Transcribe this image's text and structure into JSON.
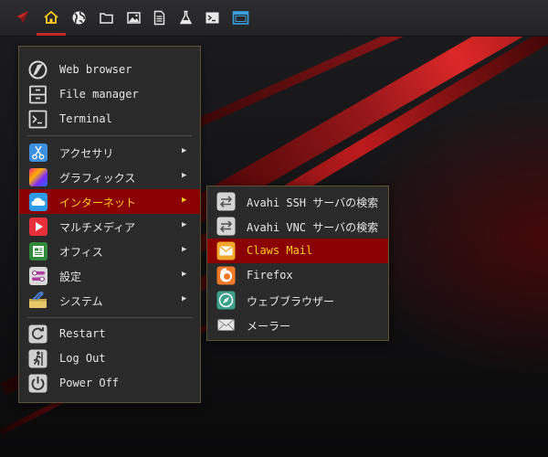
{
  "panel": {
    "buttons": [
      {
        "name": "launcher-button",
        "icon": "rocket-icon"
      },
      {
        "name": "home-button",
        "icon": "home-icon"
      },
      {
        "name": "browser-button",
        "icon": "globe-icon"
      },
      {
        "name": "files-button",
        "icon": "folder-icon"
      },
      {
        "name": "images-button",
        "icon": "image-icon"
      },
      {
        "name": "documents-button",
        "icon": "document-icon"
      },
      {
        "name": "science-button",
        "icon": "flask-icon"
      },
      {
        "name": "terminal-button",
        "icon": "terminal-icon"
      },
      {
        "name": "desktop-button",
        "icon": "window-icon"
      }
    ],
    "accent": "#c0282a",
    "home_color": "#ffcc1f",
    "window_icon_color": "#3aa0e0"
  },
  "main_menu": {
    "favorites": [
      {
        "label": "Web browser",
        "icon": "web-browser-icon"
      },
      {
        "label": "File manager",
        "icon": "file-manager-icon"
      },
      {
        "label": "Terminal",
        "icon": "terminal-icon"
      }
    ],
    "categories": [
      {
        "label": "アクセサリ",
        "icon": "accessories-icon",
        "active": false
      },
      {
        "label": "グラフィックス",
        "icon": "graphics-icon",
        "active": false
      },
      {
        "label": "インターネット",
        "icon": "internet-icon",
        "active": true
      },
      {
        "label": "マルチメディア",
        "icon": "multimedia-icon",
        "active": false
      },
      {
        "label": "オフィス",
        "icon": "office-icon",
        "active": false
      },
      {
        "label": "設定",
        "icon": "settings-icon",
        "active": false
      },
      {
        "label": "システム",
        "icon": "system-icon",
        "active": false
      }
    ],
    "submenu_arrow": "▶",
    "session": [
      {
        "label": "Restart",
        "icon": "restart-icon"
      },
      {
        "label": "Log Out",
        "icon": "logout-icon"
      },
      {
        "label": "Power Off",
        "icon": "power-icon"
      }
    ]
  },
  "internet_submenu": {
    "items": [
      {
        "label": "Avahi SSH サーバの検索",
        "icon": "avahi-icon",
        "active": false
      },
      {
        "label": "Avahi VNC サーバの検索",
        "icon": "avahi-icon",
        "active": false
      },
      {
        "label": "Claws Mail",
        "icon": "mail-icon",
        "active": true
      },
      {
        "label": "Firefox",
        "icon": "firefox-icon",
        "active": false
      },
      {
        "label": "ウェブブラウザー",
        "icon": "web-browser-compass-icon",
        "active": false
      },
      {
        "label": "メーラー",
        "icon": "envelope-icon",
        "active": false
      }
    ]
  },
  "colors": {
    "highlight_bg": "#8b0000",
    "highlight_text": "#ffcc1f",
    "menu_bg": "#2a2a2b",
    "menu_border": "#5d5238",
    "text": "#e6e6e6"
  }
}
